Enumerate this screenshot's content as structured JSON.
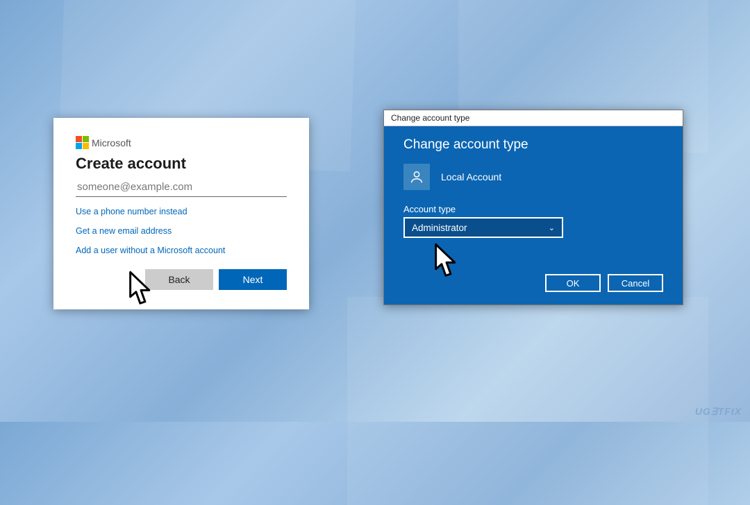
{
  "logo": {
    "brand": "Microsoft",
    "colors": {
      "tl": "#f25022",
      "tr": "#7fba00",
      "bl": "#00a4ef",
      "br": "#ffb900"
    }
  },
  "createDialog": {
    "heading": "Create account",
    "emailPlaceholder": "someone@example.com",
    "emailValue": "",
    "links": {
      "phone": "Use a phone number instead",
      "newEmail": "Get a new email address",
      "noMsAccount": "Add a user without a Microsoft account"
    },
    "buttons": {
      "back": "Back",
      "next": "Next"
    }
  },
  "changeDialog": {
    "titlebar": "Change account type",
    "heading": "Change account type",
    "accountName": "Local Account",
    "fieldLabel": "Account type",
    "selectedType": "Administrator",
    "buttons": {
      "ok": "OK",
      "cancel": "Cancel"
    }
  },
  "watermark": "UG∃TFIX",
  "colors": {
    "msBlue": "#0067b8",
    "panelBlue": "#0b65b2",
    "panelBlueDark": "#0a4f8d"
  }
}
